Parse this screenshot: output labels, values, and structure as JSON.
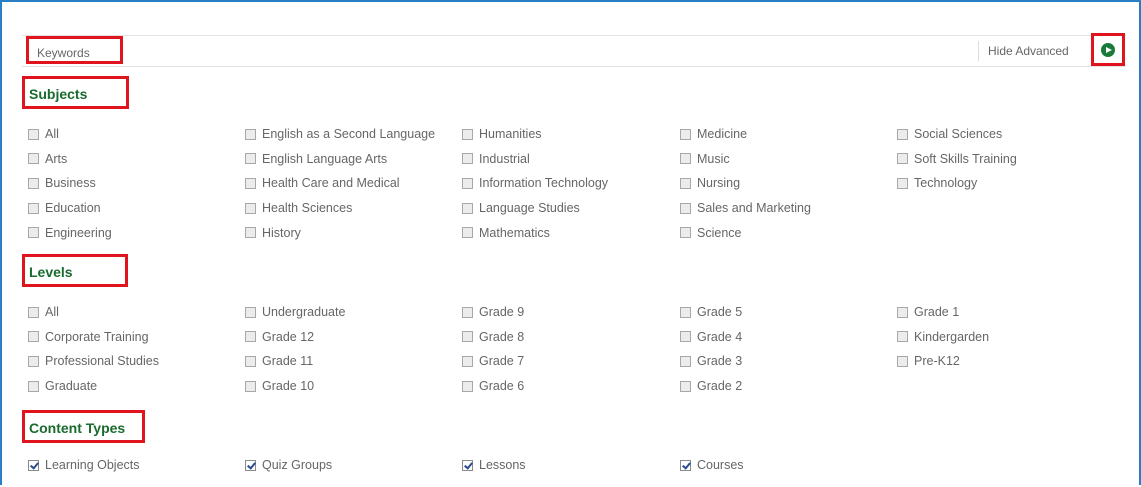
{
  "search": {
    "keywords_placeholder": "Keywords",
    "hide_advanced_label": "Hide Advanced"
  },
  "subjects": {
    "heading": "Subjects",
    "columns": [
      [
        "All",
        "Arts",
        "Business",
        "Education",
        "Engineering"
      ],
      [
        "English as a Second Language",
        "English Language Arts",
        "Health Care and Medical",
        "Health Sciences",
        "History"
      ],
      [
        "Humanities",
        "Industrial",
        "Information Technology",
        "Language Studies",
        "Mathematics"
      ],
      [
        "Medicine",
        "Music",
        "Nursing",
        "Sales and Marketing",
        "Science"
      ],
      [
        "Social Sciences",
        "Soft Skills Training",
        "Technology"
      ]
    ]
  },
  "levels": {
    "heading": "Levels",
    "columns": [
      [
        "All",
        "Corporate Training",
        "Professional Studies",
        "Graduate"
      ],
      [
        "Undergraduate",
        "Grade 12",
        "Grade 11",
        "Grade 10"
      ],
      [
        "Grade 9",
        "Grade 8",
        "Grade 7",
        "Grade 6"
      ],
      [
        "Grade 5",
        "Grade 4",
        "Grade 3",
        "Grade 2"
      ],
      [
        "Grade 1",
        "Kindergarden",
        "Pre-K12"
      ]
    ]
  },
  "content_types": {
    "heading": "Content Types",
    "items": [
      {
        "label": "Learning Objects",
        "checked": true
      },
      {
        "label": "Quiz Groups",
        "checked": true
      },
      {
        "label": "Lessons",
        "checked": true
      },
      {
        "label": "Courses",
        "checked": true
      }
    ]
  },
  "colors": {
    "frame_border": "#2a7fc4",
    "highlight_box": "#e0141e",
    "heading_green": "#1a6b2e",
    "go_button": "#1a7a3a"
  },
  "icons": {
    "go_button": "play-circle-icon",
    "checkbox": "checkbox-icon"
  }
}
